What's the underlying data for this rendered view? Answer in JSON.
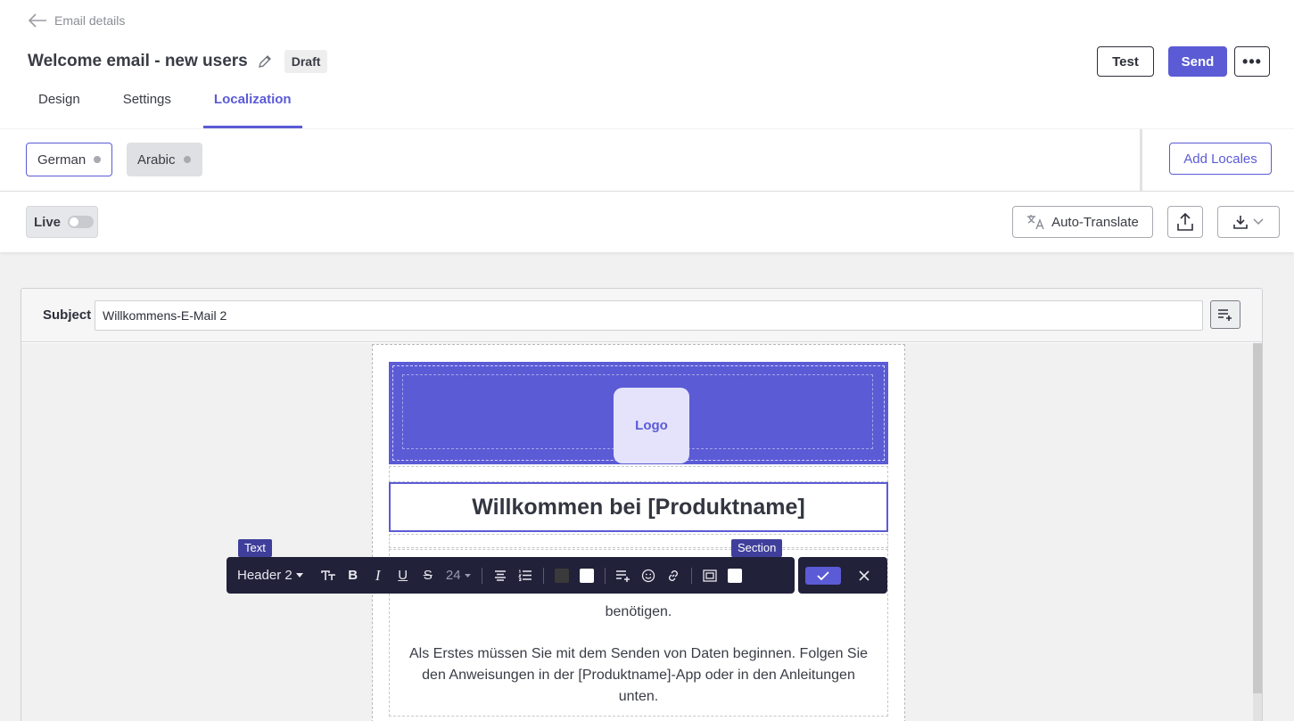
{
  "header": {
    "back_label": "Email details",
    "title": "Welcome email - new users",
    "status": "Draft",
    "tabs": [
      {
        "label": "Design",
        "active": false
      },
      {
        "label": "Settings",
        "active": false
      },
      {
        "label": "Localization",
        "active": true
      }
    ],
    "test_label": "Test",
    "send_label": "Send",
    "more_label": "•••"
  },
  "locales": {
    "items": [
      {
        "label": "German",
        "selected": true
      },
      {
        "label": "Arabic",
        "selected": false
      }
    ],
    "add_label": "Add Locales"
  },
  "toolbar": {
    "live_label": "Live",
    "live_on": false,
    "auto_translate_label": "Auto-Translate"
  },
  "editor": {
    "subject_label": "Subject",
    "subject_value": "Willkommens-E-Mail 2",
    "logo_label": "Logo",
    "heading": "Willkommen bei [Produktname]",
    "body_line_partial": "benötigen.",
    "body_paragraph": "Als Erstes müssen Sie mit dem Senden von Daten beginnen. Folgen Sie den Anweisungen in der [Produktname]-App oder in den Anleitungen unten.",
    "tag_text": "Text",
    "tag_section": "Section"
  },
  "format_toolbar": {
    "block_type": "Header 2",
    "font_size": "24",
    "text_color": "#3a3a3a",
    "bg_color": "#ffffff",
    "section_color": "#ffffff"
  },
  "colors": {
    "accent": "#5b5bd6",
    "toolbar_bg": "#21213a"
  }
}
